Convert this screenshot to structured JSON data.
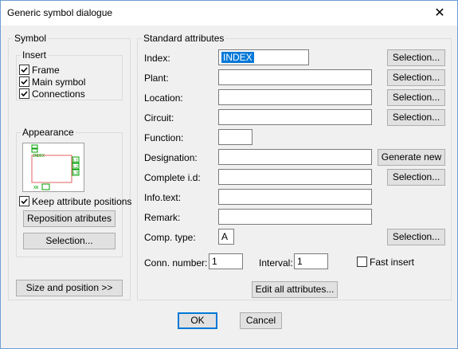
{
  "window": {
    "title": "Generic symbol dialogue",
    "close_glyph": "✕"
  },
  "symbol": {
    "group_label": "Symbol",
    "insert": {
      "label": "Insert",
      "options": [
        {
          "label": "Frame",
          "checked": true
        },
        {
          "label": "Main symbol",
          "checked": true
        },
        {
          "label": "Connections",
          "checked": true
        }
      ]
    },
    "appearance": {
      "label": "Appearance",
      "preview_text": {
        "index": "INDEX",
        "conn1": "L1",
        "conn2": "L2",
        "conn3": "L3",
        "bottom": "XN"
      },
      "keep_positions": {
        "label": "Keep attribute positions",
        "checked": true
      },
      "reposition_label": "Reposition atributes",
      "selection_label": "Selection..."
    },
    "size_position_label": "Size and position >>"
  },
  "attributes": {
    "group_label": "Standard attributes",
    "rows": [
      {
        "label": "Index:",
        "value": "INDEX",
        "button": "Selection..."
      },
      {
        "label": "Plant:",
        "value": "",
        "button": "Selection..."
      },
      {
        "label": "Location:",
        "value": "",
        "button": "Selection..."
      },
      {
        "label": "Circuit:",
        "value": "",
        "button": "Selection..."
      },
      {
        "label": "Function:",
        "value": ""
      },
      {
        "label": "Designation:",
        "value": "",
        "button": "Generate new"
      },
      {
        "label": "Complete i.d:",
        "value": "",
        "button": "Selection..."
      },
      {
        "label": "Info.text:",
        "value": ""
      },
      {
        "label": "Remark:",
        "value": ""
      },
      {
        "label": "Comp. type:",
        "value": "A",
        "button": "Selection..."
      }
    ],
    "conn_number": {
      "label": "Conn. number:",
      "value": "1"
    },
    "interval": {
      "label": "Interval:",
      "value": "1"
    },
    "fast_insert": {
      "label": "Fast insert",
      "checked": false
    },
    "edit_all_label": "Edit all attributes..."
  },
  "footer": {
    "ok_label": "OK",
    "cancel_label": "Cancel"
  },
  "colors": {
    "preview_frame": "#e06060",
    "preview_symbols": "#00a000",
    "selection": "#0078d7"
  }
}
